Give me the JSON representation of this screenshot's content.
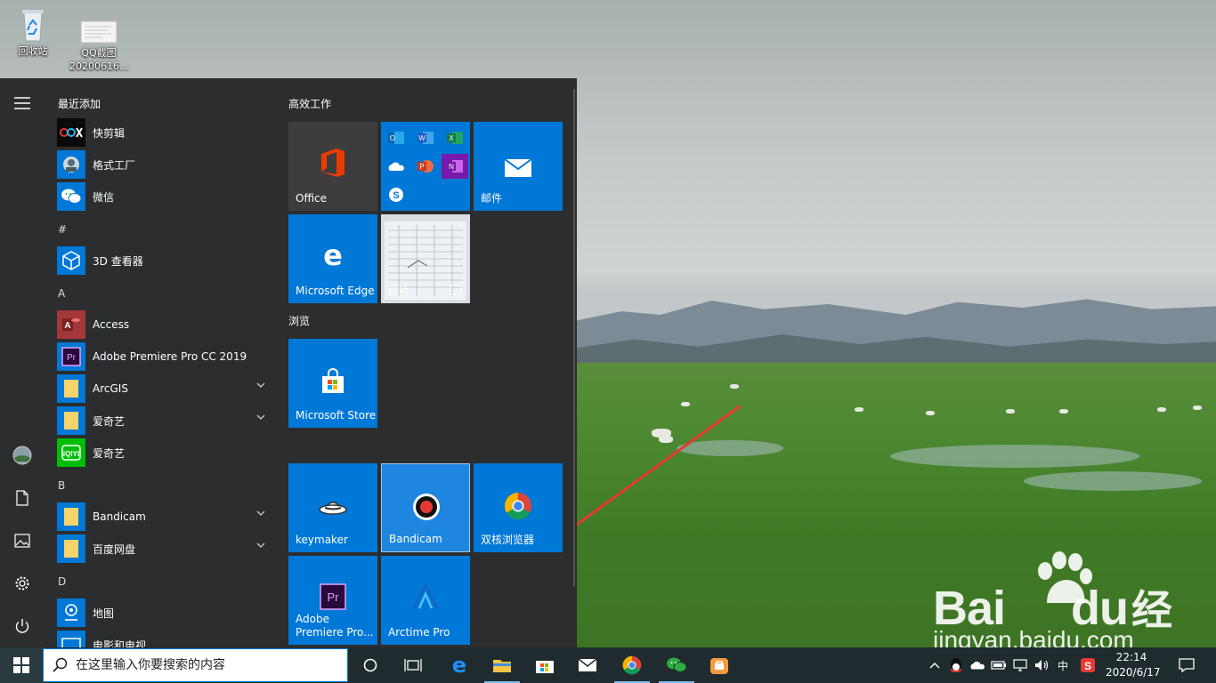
{
  "desktop": {
    "icons": [
      {
        "label": "回收站"
      },
      {
        "label": "QQ截图",
        "sublabel": "20200616..."
      }
    ],
    "watermark": {
      "brand": "Bai",
      "brand_suffix": "du",
      "brand_cn": "经验",
      "url": "jingyan.baidu.com"
    }
  },
  "start_menu": {
    "recent_header": "最近添加",
    "recent_items": [
      {
        "label": "快剪辑",
        "icon": "kuaijianji-icon"
      },
      {
        "label": "格式工厂",
        "icon": "format-factory-icon"
      },
      {
        "label": "微信",
        "icon": "wechat-icon"
      }
    ],
    "sections": [
      {
        "letter": "#",
        "items": [
          {
            "label": "3D 查看器",
            "icon": "3d-viewer-icon"
          }
        ]
      },
      {
        "letter": "A",
        "items": [
          {
            "label": "Access",
            "icon": "access-icon"
          },
          {
            "label": "Adobe Premiere Pro CC 2019",
            "icon": "premiere-icon"
          },
          {
            "label": "ArcGIS",
            "icon": "folder-icon",
            "expandable": true
          },
          {
            "label": "爱奇艺",
            "icon": "folder-icon",
            "expandable": true
          },
          {
            "label": "爱奇艺",
            "icon": "iqiyi-icon"
          }
        ]
      },
      {
        "letter": "B",
        "items": [
          {
            "label": "Bandicam",
            "icon": "folder-icon",
            "expandable": true
          },
          {
            "label": "百度网盘",
            "icon": "folder-icon",
            "expandable": true
          }
        ]
      },
      {
        "letter": "D",
        "items": [
          {
            "label": "地图",
            "icon": "maps-icon"
          },
          {
            "label": "电影和电视",
            "icon": "movies-tv-icon"
          }
        ]
      }
    ],
    "tile_groups": [
      {
        "title": "高效工作"
      },
      {
        "title": "浏览"
      }
    ],
    "tiles": {
      "office": "Office",
      "mail": "邮件",
      "edge": "Microsoft Edge",
      "photos": "照片",
      "store": "Microsoft Store",
      "keymaker": "keymaker",
      "bandicam": "Bandicam",
      "browser": "双核浏览器",
      "premiere": "Adobe Premiere Pro...",
      "arctime": "Arctime Pro"
    }
  },
  "taskbar": {
    "search_placeholder": "在这里输入你要搜索的内容",
    "ime": "中",
    "time": "22:14",
    "date": "2020/6/17"
  },
  "colors": {
    "accent": "#0078d7",
    "menu_bg": "#2b2d2e",
    "taskbar_bg": "#1f2b2e",
    "annotation_arrow": "#e53935"
  }
}
